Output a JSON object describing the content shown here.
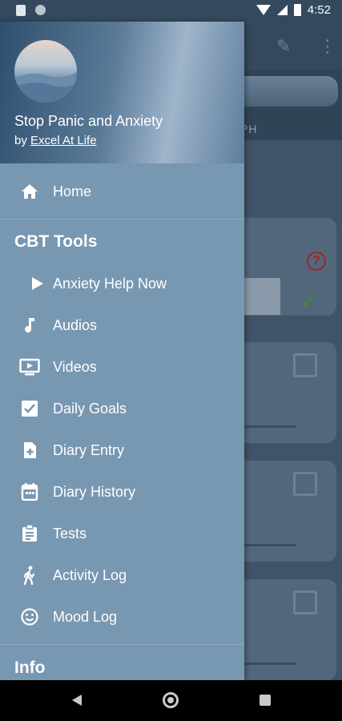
{
  "status_bar": {
    "time": "4:52"
  },
  "background": {
    "tab_text": "PH"
  },
  "drawer": {
    "header": {
      "app_title": "Stop Panic and Anxiety",
      "by_prefix": "by",
      "author_link": "Excel At Life"
    },
    "home_item": {
      "label": "Home",
      "icon": "home-icon"
    },
    "sections": [
      {
        "title": "CBT Tools",
        "items": [
          {
            "label": "Anxiety Help Now",
            "icon": "play-icon"
          },
          {
            "label": "Audios",
            "icon": "music-note-icon"
          },
          {
            "label": "Videos",
            "icon": "video-icon"
          },
          {
            "label": "Daily Goals",
            "icon": "checkbox-icon"
          },
          {
            "label": "Diary Entry",
            "icon": "add-document-icon"
          },
          {
            "label": "Diary History",
            "icon": "calendar-icon"
          },
          {
            "label": "Tests",
            "icon": "clipboard-icon"
          },
          {
            "label": "Activity Log",
            "icon": "walking-icon"
          },
          {
            "label": "Mood Log",
            "icon": "smiley-icon"
          }
        ]
      },
      {
        "title": "Info"
      }
    ]
  },
  "colors": {
    "drawer_background": "#7897b1",
    "status_bar": "#34495d"
  }
}
